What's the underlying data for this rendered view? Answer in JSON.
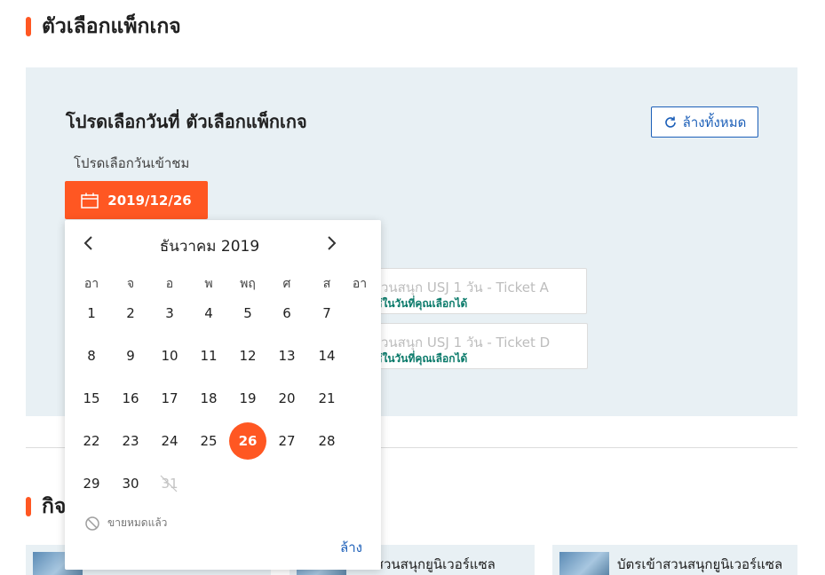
{
  "section": {
    "title": "ตัวเลือกแพ็กเกจ"
  },
  "panel": {
    "title": "โปรดเลือกวันที่ ตัวเลือกแพ็กเกจ",
    "clear_all": "ล้างทั้งหมด",
    "date_label": "โปรดเลือกวันเข้าชม",
    "selected_date": "2019/12/26"
  },
  "packages": [
    {
      "name": "เข้าสวนสนุก USJ 1 วัน - Ticket A",
      "note": "ารถใช้ในวันที่คุณเลือกได้"
    },
    {
      "name": "เข้าสวนสนุก USJ 1 วัน - Ticket D",
      "note": "ารถใช้ในวันที่คุณเลือกได้"
    }
  ],
  "section2": {
    "title": "กิจ"
  },
  "activities": [
    {
      "name": ""
    },
    {
      "name": "เข้าสวนสนุกยูนิเวอร์แซล"
    },
    {
      "name": "บัตรเข้าสวนสนุกยูนิเวอร์แซล"
    }
  ],
  "calendar": {
    "month_label": "ธันวาคม 2019",
    "weekdays": [
      "อา",
      "จ",
      "อ",
      "พ",
      "พฤ",
      "ศ",
      "ส",
      "อา"
    ],
    "days": [
      "1",
      "2",
      "3",
      "4",
      "5",
      "6",
      "7",
      "8",
      "9",
      "10",
      "11",
      "12",
      "13",
      "14",
      "15",
      "16",
      "17",
      "18",
      "19",
      "20",
      "21",
      "22",
      "23",
      "24",
      "25",
      "26",
      "27",
      "28",
      "29",
      "30",
      "31"
    ],
    "selected_day": "26",
    "disabled_days": [
      "31"
    ],
    "legend_soldout": "ขายหมดแล้ว",
    "clear": "ล้าง"
  },
  "colors": {
    "accent": "#ff5722",
    "link": "#1c5fb8",
    "panel_bg": "#e8f0f4"
  }
}
